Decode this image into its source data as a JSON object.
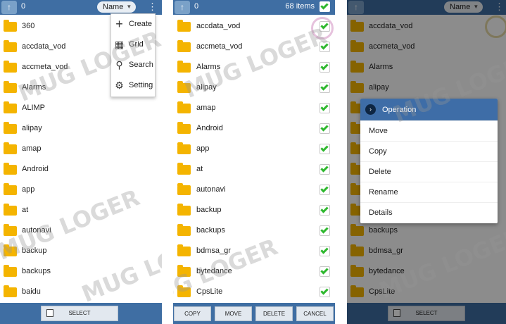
{
  "panel1": {
    "selection_count": "0",
    "sort_label": "Name",
    "files": [
      "360",
      "accdata_vod",
      "accmeta_vod",
      "Alarms",
      "ALIMP",
      "alipay",
      "amap",
      "Android",
      "app",
      "at",
      "autonavi",
      "backup",
      "backups",
      "baidu"
    ],
    "menu": [
      {
        "icon": "plus-icon",
        "label": "Create"
      },
      {
        "icon": "grid-icon",
        "label": "Grid"
      },
      {
        "icon": "search-icon",
        "label": "Search"
      },
      {
        "icon": "gear-icon",
        "label": "Setting"
      }
    ],
    "select_label": "SELECT"
  },
  "panel2": {
    "selection_count": "0",
    "items_count": "68 items",
    "files": [
      "accdata_vod",
      "accmeta_vod",
      "Alarms",
      "alipay",
      "amap",
      "Android",
      "app",
      "at",
      "autonavi",
      "backup",
      "backups",
      "bdmsa_gr",
      "bytedance",
      "CpsLite"
    ],
    "buttons": [
      "COPY",
      "MOVE",
      "DELETE",
      "CANCEL"
    ]
  },
  "panel3": {
    "sort_label": "Name",
    "files": [
      "accdata_vod",
      "accmeta_vod",
      "Alarms",
      "alipay",
      "",
      "",
      "",
      "",
      "",
      "",
      "backups",
      "bdmsa_gr",
      "bytedance",
      "CpsLite"
    ],
    "dialog": {
      "title": "Operation",
      "items": [
        "Move",
        "Copy",
        "Delete",
        "Rename",
        "Details"
      ]
    },
    "select_label": "SELECT"
  },
  "watermark": "MUG LOGER",
  "colors": {
    "bar": "#3f6ea3",
    "folder": "#f4b400",
    "check": "#2eb82e"
  }
}
